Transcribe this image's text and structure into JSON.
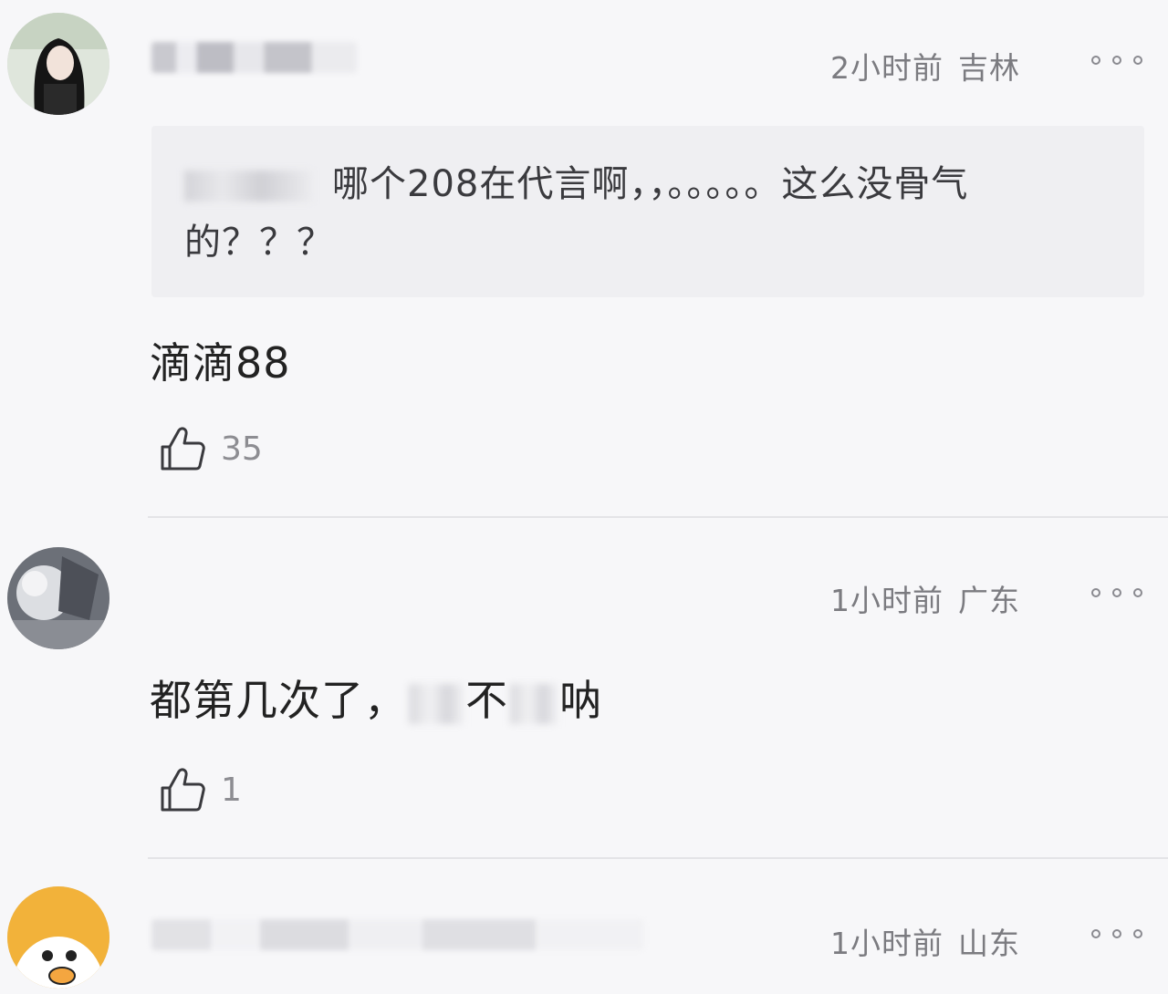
{
  "comments": [
    {
      "time": "2小时前",
      "location": "吉林",
      "quote_text": "哪个208在代言啊，，。。。。。这么没骨气的？？？",
      "body": "滴滴88",
      "likes": "35"
    },
    {
      "time": "1小时前",
      "location": "广东",
      "body_part1": "都第几次了，",
      "body_part2": "不",
      "body_part3": "呐",
      "likes": "1"
    },
    {
      "time": "1小时前",
      "location": "山东"
    }
  ],
  "icons": {
    "like": "thumbs-up-icon",
    "more": "more-dots-icon"
  }
}
